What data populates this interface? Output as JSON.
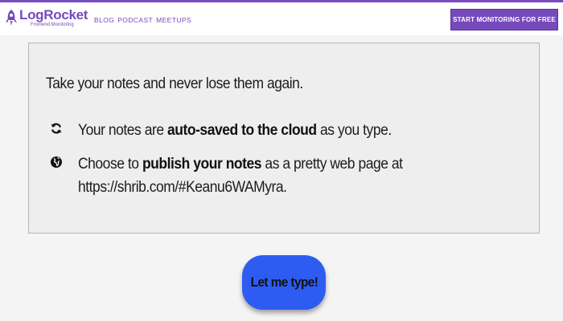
{
  "header": {
    "logo_text": "LogRocket",
    "logo_subtitle": "Frontend Monitoring",
    "nav": [
      "BLOG",
      "PODCAST",
      "MEETUPS"
    ],
    "cta_label": "START MONITORING FOR FREE"
  },
  "card": {
    "heading": "Take your notes and never lose them again.",
    "feature1": {
      "icon": "refresh-icon",
      "before": "Your notes are ",
      "bold": "auto-saved to the cloud",
      "after": " as you type."
    },
    "feature2": {
      "icon": "globe-icon",
      "before": "Choose to ",
      "bold": "publish your notes",
      "after": " as a pretty web page at",
      "line2": "https://shrib.com/#Keanu6WAMyra."
    }
  },
  "action": {
    "button_label": "Let me type!"
  },
  "colors": {
    "brand": "#764abc",
    "button": "#2e5cf2"
  }
}
